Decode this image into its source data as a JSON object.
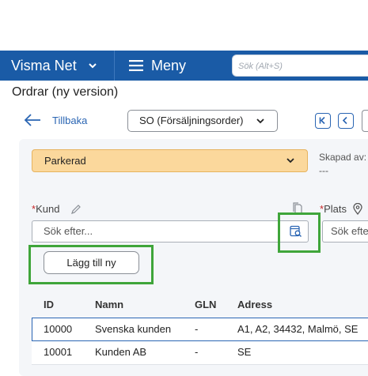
{
  "topbar": {
    "brand": "Visma Net",
    "brand_chevron_icon": "chevron-down-icon",
    "menu_icon": "hamburger-icon",
    "menu_label": "Meny",
    "search_placeholder": "Sök (Alt+S)",
    "bg_color": "#1a5ba6"
  },
  "page": {
    "title": "Ordrar (ny version)"
  },
  "toolbar": {
    "back_label": "Tillbaka",
    "order_type": "SO (Försäljningsorder)",
    "nav_first_icon": "first-page-icon",
    "nav_prev_icon": "chevron-left-icon"
  },
  "header": {
    "status": "Parkerad",
    "status_color": "#fbd89c",
    "created_by_label": "Skapad av:",
    "created_by_value": "---"
  },
  "customer": {
    "required_mark": "*",
    "label": "Kund",
    "edit_icon": "pencil-icon",
    "copy_icon": "copy-icon",
    "placeholder": "Sök efter...",
    "lookup_icon": "lookup-search-icon",
    "add_new_label": "Lägg till ny"
  },
  "location": {
    "required_mark": "*",
    "label": "Plats",
    "pin_icon": "location-pin-icon",
    "placeholder": "Sök efter..."
  },
  "results_table": {
    "columns": [
      "ID",
      "Namn",
      "GLN",
      "Adress"
    ],
    "rows": [
      {
        "id": "10000",
        "name": "Svenska kunden",
        "gln": "-",
        "address": "A1, A2, 34432, Malmö, SE"
      },
      {
        "id": "10001",
        "name": "Kunden AB",
        "gln": "-",
        "address": "SE"
      }
    ]
  },
  "highlight_color": "#3fa53a"
}
